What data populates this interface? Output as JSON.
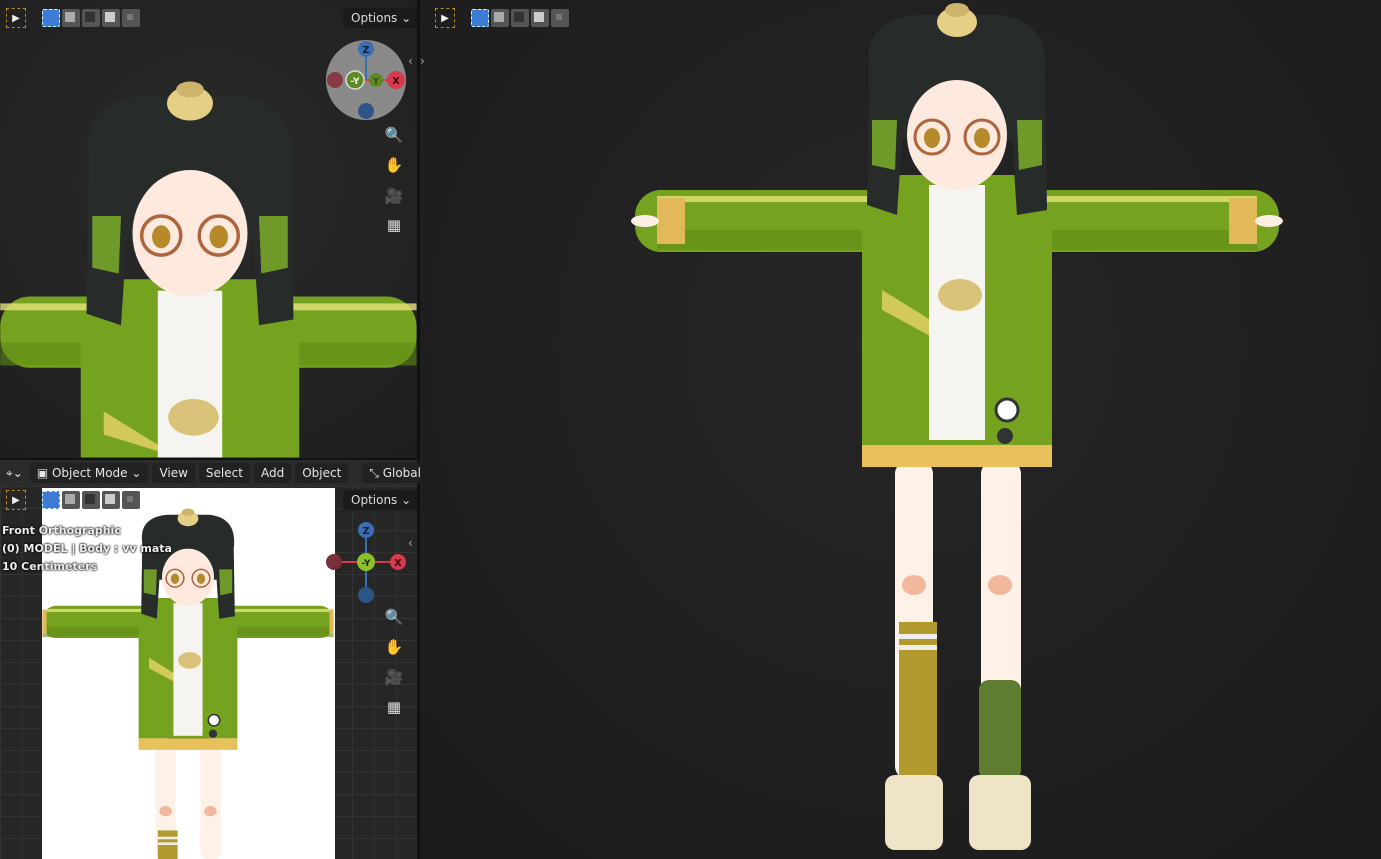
{
  "header": {
    "editor_type_icon": "viewport-icon",
    "mode": "Object Mode",
    "menus": [
      "View",
      "Select",
      "Add",
      "Object"
    ],
    "transform_orientation": "Global"
  },
  "viewports": {
    "top_left": {
      "options_label": "Options"
    },
    "right": {},
    "bottom_left": {
      "options_label": "Options",
      "overlay": {
        "view_name": "Front Orthographic",
        "object_info": "(0) MODEL | Body : vv mata",
        "scale": "10 Centimeters"
      }
    }
  },
  "gizmo": {
    "z": "Z",
    "x": "X",
    "neg_y": "-Y",
    "y": "Y"
  },
  "icons": [
    "select-box-icon",
    "mode-new-icon",
    "mode-extend-icon",
    "mode-subtract-icon",
    "mode-invert-icon",
    "mode-intersect-icon",
    "zoom-icon",
    "pan-hand-icon",
    "camera-icon",
    "perspective-grid-icon"
  ],
  "colors": {
    "x_axis": "#d63a4c",
    "y_axis": "#7ab52a",
    "z_axis": "#3a6fb5",
    "accent": "#3d7bd6",
    "jacket": "#76a31f"
  }
}
